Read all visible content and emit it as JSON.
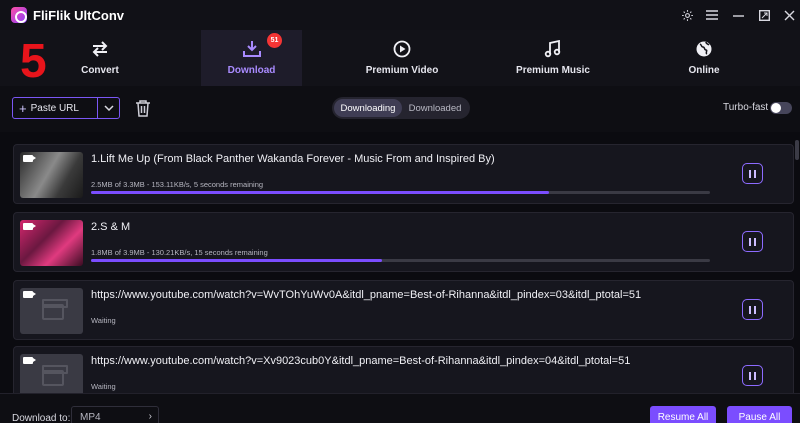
{
  "app": {
    "title": "FliFlik UltConv"
  },
  "step_number": "5",
  "nav": {
    "items": [
      {
        "label": "Convert",
        "icon": "convert-arrows-icon"
      },
      {
        "label": "Download",
        "icon": "download-tray-icon",
        "badge": "51",
        "active": true
      },
      {
        "label": "Premium Video",
        "icon": "play-circle-icon"
      },
      {
        "label": "Premium Music",
        "icon": "music-note-icon"
      },
      {
        "label": "Online",
        "icon": "globe-icon"
      }
    ]
  },
  "toolbar": {
    "paste_label": "Paste URL",
    "tabs": [
      {
        "label": "Downloading",
        "active": true
      },
      {
        "label": "Downloaded",
        "active": false
      }
    ],
    "turbo_label": "Turbo-fast",
    "turbo_on": false
  },
  "downloads": [
    {
      "title": "1.Lift Me Up (From Black Panther Wakanda Forever - Music From and Inspired By)",
      "status": "2.5MB of 3.3MB -  153.11KB/s, 5 seconds remaining",
      "progress": 0.74,
      "thumb": "photo-mono"
    },
    {
      "title": "2.S & M",
      "status": "1.8MB of 3.9MB -  130.21KB/s, 15 seconds remaining",
      "progress": 0.47,
      "thumb": "photo-pink"
    },
    {
      "title": "https://www.youtube.com/watch?v=WvTOhYuWv0A&itdl_pname=Best-of-Rihanna&itdl_pindex=03&itdl_ptotal=51",
      "status": "Waiting",
      "progress": null,
      "thumb": "placeholder"
    },
    {
      "title": "https://www.youtube.com/watch?v=Xv9023cub0Y&itdl_pname=Best-of-Rihanna&itdl_pindex=04&itdl_ptotal=51",
      "status": "Waiting",
      "progress": null,
      "thumb": "placeholder"
    }
  ],
  "footer": {
    "download_to_label": "Download to:",
    "format": "MP4",
    "resume_all": "Resume All",
    "pause_all": "Pause All"
  },
  "colors": {
    "accent": "#7b4dff",
    "badge": "#f53535",
    "step": "#e8141b"
  }
}
